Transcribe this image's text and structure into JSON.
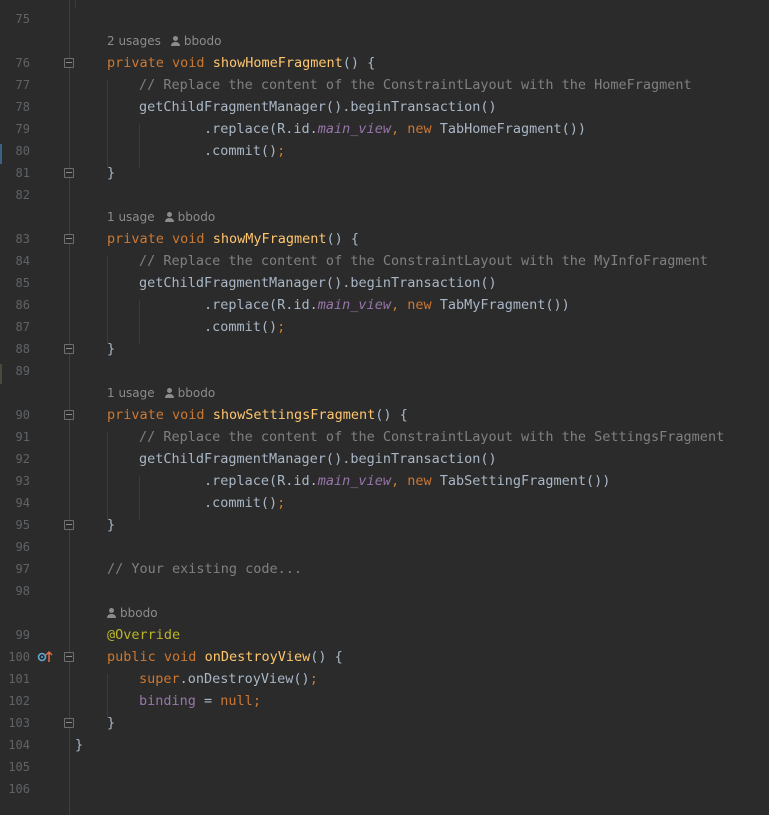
{
  "editor": {
    "accent_colors": {
      "keyword": "#cc7832",
      "method": "#ffc66d",
      "comment": "#808080",
      "field": "#9876aa",
      "annotation": "#bbb529",
      "text": "#a9b7c6",
      "background": "#2b2b2b"
    },
    "hints": {
      "show_home": {
        "usages": "2 usages",
        "author": "bbodo"
      },
      "show_my": {
        "usages": "1 usage",
        "author": "bbodo"
      },
      "show_settings": {
        "usages": "1 usage",
        "author": "bbodo"
      },
      "on_destroy": {
        "author": "bbodo"
      }
    },
    "lines": {
      "n75": "75",
      "n76": "76",
      "n77": "77",
      "n78": "78",
      "n79": "79",
      "n80": "80",
      "n81": "81",
      "n82": "82",
      "n83": "83",
      "n84": "84",
      "n85": "85",
      "n86": "86",
      "n87": "87",
      "n88": "88",
      "n89": "89",
      "n90": "90",
      "n91": "91",
      "n92": "92",
      "n93": "93",
      "n94": "94",
      "n95": "95",
      "n96": "96",
      "n97": "97",
      "n98": "98",
      "n99": "99",
      "n100": "100",
      "n101": "101",
      "n102": "102",
      "n103": "103",
      "n104": "104",
      "n105": "105",
      "n106": "106"
    },
    "code": {
      "kw_private": "private",
      "kw_void": "void",
      "kw_public": "public",
      "kw_new": "new",
      "kw_super": "super",
      "kw_null": "null",
      "fn_home": "showHomeFragment",
      "fn_my": "showMyFragment",
      "fn_settings": "showSettingsFragment",
      "fn_destroy": "onDestroyView",
      "parens_open": "() {",
      "close_brace": "}",
      "comment_home": "// Replace the content of the ConstraintLayout with the HomeFragment",
      "comment_my": "// Replace the content of the ConstraintLayout with the MyInfoFragment",
      "comment_settings": "// Replace the content of the ConstraintLayout with the SettingsFragment",
      "comment_existing": "// Your existing code...",
      "begin_tx": "getChildFragmentManager().beginTransaction()",
      "replace_prefix": ".replace(R.id.",
      "main_view": "main_view",
      "comma": ", ",
      "tab_home": " TabHomeFragment())",
      "tab_my": " TabMyFragment())",
      "tab_setting": " TabSettingFragment())",
      "commit": ".commit()",
      "semicolon": ";",
      "annotation": "@Override",
      "super_call": ".onDestroyView()",
      "binding": "binding",
      "assign": " = "
    }
  }
}
